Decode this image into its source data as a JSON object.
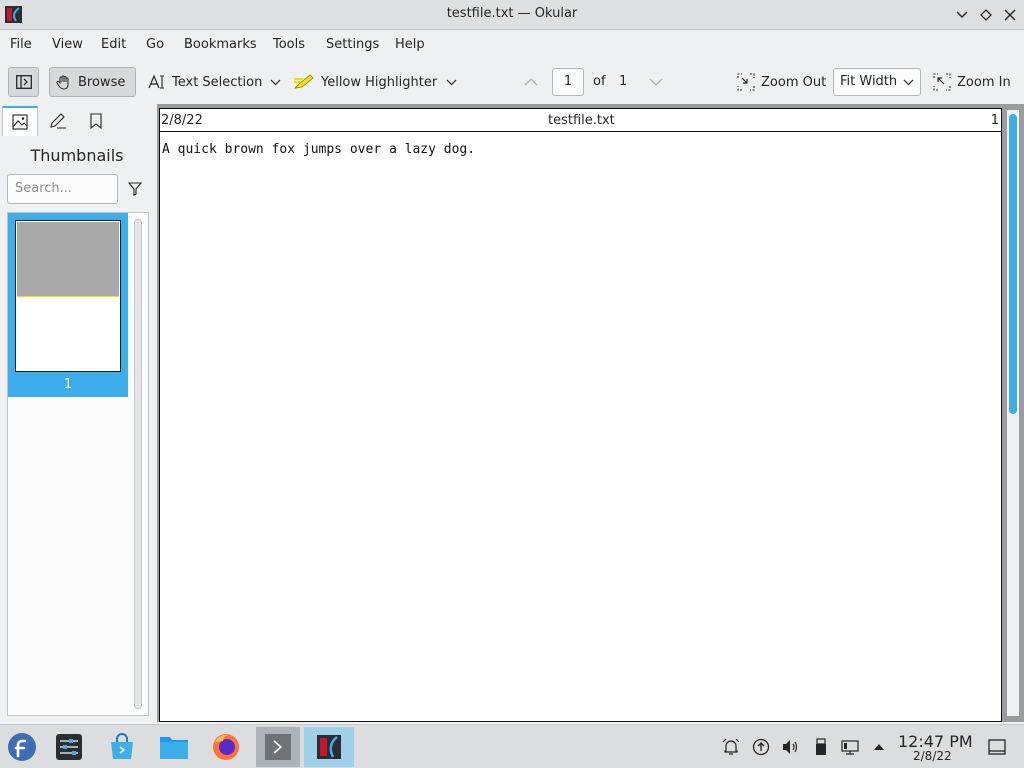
{
  "window": {
    "title": "testfile.txt — Okular"
  },
  "menu": [
    "File",
    "Edit",
    "View",
    "Go",
    "Bookmarks",
    "Tools",
    "Settings",
    "Help"
  ],
  "menu_labels": {
    "file": "File",
    "view": "View",
    "edit": "Edit",
    "go": "Go",
    "bookmarks": "Bookmarks",
    "tools": "Tools",
    "settings": "Settings",
    "help": "Help"
  },
  "toolbar": {
    "browse_label": "Browse",
    "text_selection_label": "Text Selection",
    "highlighter_label": "Yellow Highlighter",
    "page_current": "1",
    "page_of_label": "of",
    "page_total": "1",
    "zoom_out_label": "Zoom Out",
    "zoom_mode": "Fit Width",
    "zoom_in_label": "Zoom In"
  },
  "sidebar": {
    "panel_title": "Thumbnails",
    "search_placeholder": "Search...",
    "thumbnail_page_label": "1"
  },
  "document": {
    "header_date": "2/8/22",
    "header_filename": "testfile.txt",
    "header_page": "1",
    "body_text": "A quick brown fox jumps over a lazy dog."
  },
  "taskbar": {
    "clock_time": "12:47 PM",
    "clock_date": "2/8/22"
  },
  "colors": {
    "accent": "#3daee9",
    "highlighter": "#e9e400"
  }
}
